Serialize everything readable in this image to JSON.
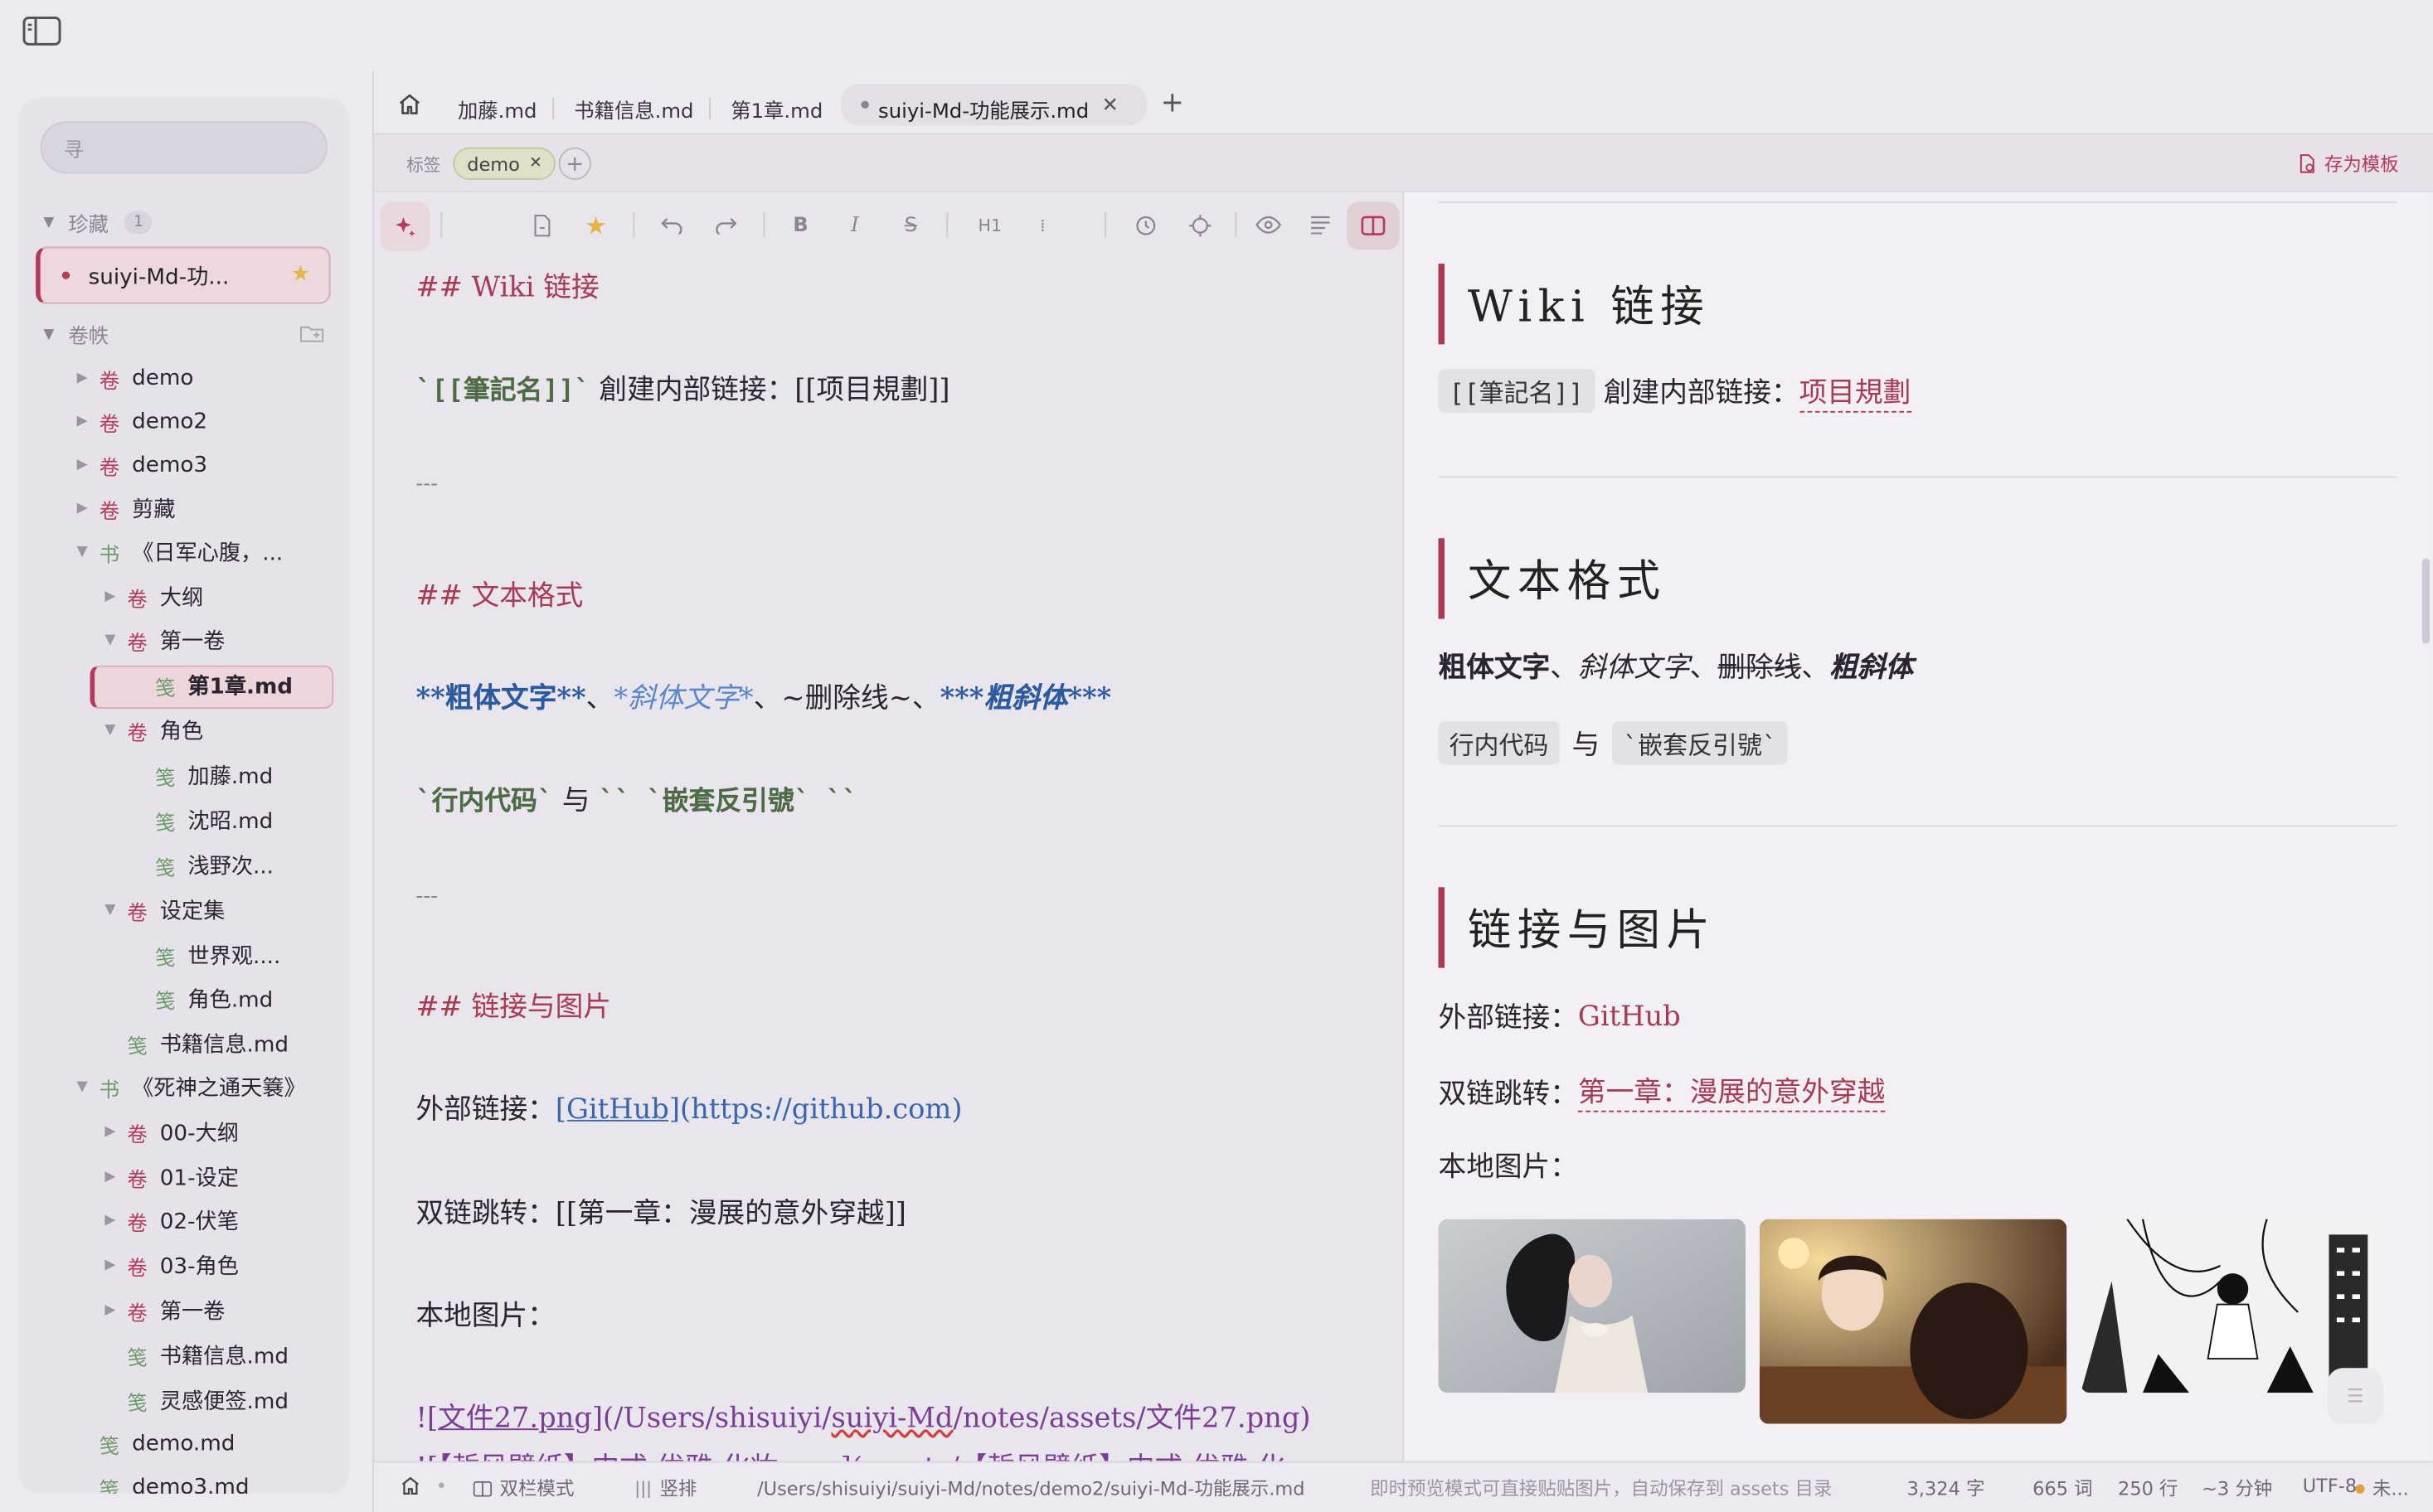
{
  "sidebar": {
    "search_placeholder": "寻",
    "favorites": {
      "label": "珍藏",
      "count": "1",
      "item": "suiyi-Md-功..."
    },
    "volumes_label": "卷帙",
    "tree": [
      {
        "glyph": "卷",
        "label": "demo"
      },
      {
        "glyph": "卷",
        "label": "demo2"
      },
      {
        "glyph": "卷",
        "label": "demo3"
      },
      {
        "glyph": "卷",
        "label": "剪藏"
      },
      {
        "glyph": "书",
        "label": "《日军心腹，..."
      },
      {
        "glyph": "卷",
        "label": "大纲"
      },
      {
        "glyph": "卷",
        "label": "第一卷"
      },
      {
        "glyph": "笺",
        "label": "第1章.md"
      },
      {
        "glyph": "卷",
        "label": "角色"
      },
      {
        "glyph": "笺",
        "label": "加藤.md"
      },
      {
        "glyph": "笺",
        "label": "沈昭.md"
      },
      {
        "glyph": "笺",
        "label": "浅野次..."
      },
      {
        "glyph": "卷",
        "label": "设定集"
      },
      {
        "glyph": "笺",
        "label": "世界观...."
      },
      {
        "glyph": "笺",
        "label": "角色.md"
      },
      {
        "glyph": "笺",
        "label": "书籍信息.md"
      },
      {
        "glyph": "书",
        "label": "《死神之通天簔》"
      },
      {
        "glyph": "卷",
        "label": "00-大纲"
      },
      {
        "glyph": "卷",
        "label": "01-设定"
      },
      {
        "glyph": "卷",
        "label": "02-伏笔"
      },
      {
        "glyph": "卷",
        "label": "03-角色"
      },
      {
        "glyph": "卷",
        "label": "第一卷"
      },
      {
        "glyph": "笺",
        "label": "书籍信息.md"
      },
      {
        "glyph": "笺",
        "label": "灵感便签.md"
      },
      {
        "glyph": "笺",
        "label": "demo.md"
      },
      {
        "glyph": "笺",
        "label": "demo3.md"
      }
    ]
  },
  "tabs": {
    "items": [
      "加藤.md",
      "书籍信息.md",
      "第1章.md"
    ],
    "active": "suiyi-Md-功能展示.md"
  },
  "tagbar": {
    "label": "标签",
    "tag": "demo",
    "save_template": "存为模板"
  },
  "toolbar": {
    "h1": "H1"
  },
  "editor": {
    "l1": "## Wiki 链接",
    "l2_code": "`[[筆記名]]`",
    "l2_text": " 創建内部链接：[[项目規劃]]",
    "hr": "---",
    "l3": "## 文本格式",
    "l4_bold": "**粗体文字**",
    "l4_sep1": "、",
    "l4_it": "*斜体文字*",
    "l4_sep2": "、~删除线~、",
    "l4_bi": "***粗斜体***",
    "l5_code": "`行内代码`",
    "l5_mid": " 与 ",
    "l5_code2": "`` `嵌套反引號` ``",
    "l6": "## 链接与图片",
    "l7_text": "外部链接：",
    "l7_link": "[GitHub]",
    "l7_url": "(https://github.com)",
    "l8": "双链跳转：[[第一章：漫展的意外穿越]]",
    "l9": "本地图片：",
    "l10_a": "![",
    "l10_b": "文件27.png",
    "l10_c": "](/Users/shisuiyi/",
    "l10_d": "suiyi-Md",
    "l10_e": "/notes/assets/文件27.png)",
    "l11": "![【哲风壁纸】中式-优雅-化妆.png](assets/【哲风壁纸】中式-优雅-化"
  },
  "preview": {
    "h1": "Wiki 链接",
    "p1_code": "[[筆記名]]",
    "p1_text": "創建内部链接：",
    "p1_link": "项目規劃",
    "h2": "文本格式",
    "p2_bold": "粗体文字",
    "p2_sep": "、",
    "p2_it": "斜体文字",
    "p2_del": "删除线",
    "p2_bi": "粗斜体",
    "p3_code1": "行内代码",
    "p3_mid": "与",
    "p3_code2": "`嵌套反引號`",
    "h3": "链接与图片",
    "p4_text": "外部链接：",
    "p4_link": "GitHub",
    "p5_text": "双链跳转：",
    "p5_link": "第一章：漫展的意外穿越",
    "p6": "本地图片："
  },
  "statusbar": {
    "mode_split": "双栏模式",
    "mode_vertical": "竖排",
    "path": "/Users/shisuiyi/suiyi-Md/notes/demo2/suiyi-Md-功能展示.md",
    "hint": "即时预览模式可直接贴贴图片，自动保存到 assets 目录",
    "chars": "3,324 字",
    "words": "665 词",
    "lines": "250 行",
    "time": "~3 分钟",
    "encoding": "UTF-8",
    "save": "未..."
  },
  "colors": {
    "accent": "#b43a5b",
    "heading": "#a83a55",
    "bold": "#2c5aa0",
    "code": "#4d6b44",
    "star": "#e6b54a"
  }
}
